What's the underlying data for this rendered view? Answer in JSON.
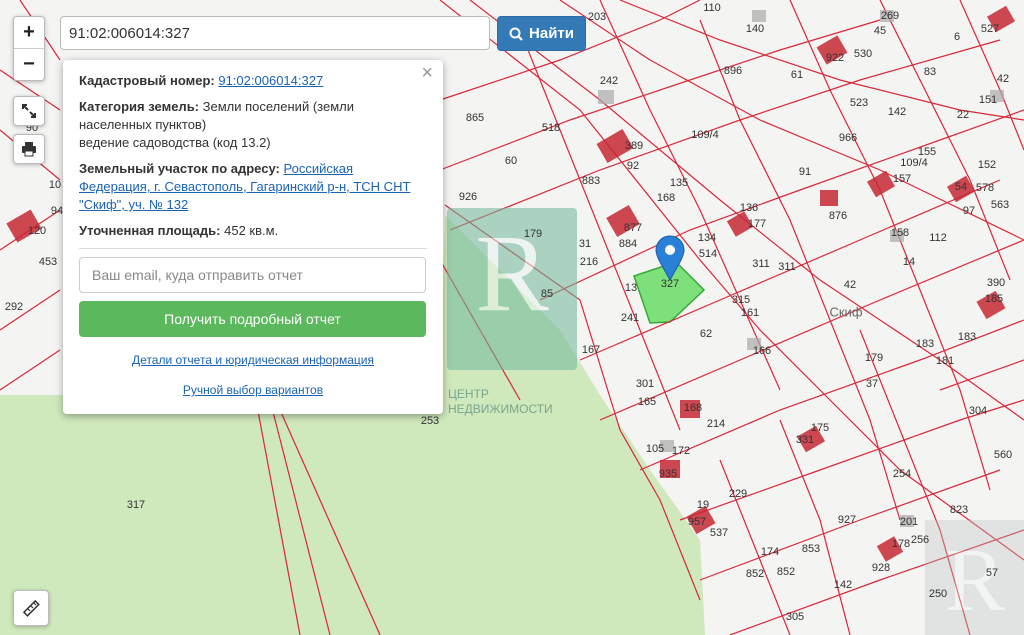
{
  "search": {
    "value": "91:02:006014:327",
    "button_label": "Найти"
  },
  "controls": {
    "zoom_in": "+",
    "zoom_out": "−"
  },
  "popup": {
    "cadastral_label": "Кадастровый номер:",
    "cadastral_value": "91:02:006014:327",
    "category_label": "Категория земель:",
    "category_value_1": "Земли поселений (земли",
    "category_value_2": "населенных пунктов)",
    "category_value_3": "ведение садоводства (код 13.2)",
    "address_label": "Земельный участок по адресу:",
    "address_link_1": "Российская",
    "address_link_2": "Федерация, г. Севастополь, Гагаринский р-н, ТСН СНТ",
    "address_link_3": "\"Скиф\", уч. № 132",
    "area_label": "Уточненная площадь:",
    "area_value": "452 кв.м.",
    "email_placeholder": "Ваш email, куда отправить отчет",
    "report_button": "Получить подробный отчет",
    "details_link": "Детали отчета и юридическая информация",
    "manual_link": "Ручной выбор вариантов"
  },
  "watermark": {
    "line1": "ЦЕНТР",
    "line2": "НЕДВИЖИМОСТИ"
  },
  "map_labels": [
    {
      "t": "203"
    },
    {
      "t": "110"
    },
    {
      "t": "140"
    },
    {
      "t": "269"
    },
    {
      "t": "45"
    },
    {
      "t": "6"
    },
    {
      "t": "527"
    },
    {
      "t": "242"
    },
    {
      "t": "896"
    },
    {
      "t": "61"
    },
    {
      "t": "922"
    },
    {
      "t": "530"
    },
    {
      "t": "83"
    },
    {
      "t": "42"
    },
    {
      "t": "151"
    },
    {
      "t": "865"
    },
    {
      "t": "518"
    },
    {
      "t": "109/4"
    },
    {
      "t": "523"
    },
    {
      "t": "142"
    },
    {
      "t": "22"
    },
    {
      "t": "389"
    },
    {
      "t": "92"
    },
    {
      "t": "966"
    },
    {
      "t": "155"
    },
    {
      "t": "60"
    },
    {
      "t": "91"
    },
    {
      "t": "109/4"
    },
    {
      "t": "157"
    },
    {
      "t": "152"
    },
    {
      "t": "883"
    },
    {
      "t": "135"
    },
    {
      "t": "168"
    },
    {
      "t": "54"
    },
    {
      "t": "578"
    },
    {
      "t": "563"
    },
    {
      "t": "97"
    },
    {
      "t": "926"
    },
    {
      "t": "877"
    },
    {
      "t": "884"
    },
    {
      "t": "136"
    },
    {
      "t": "177"
    },
    {
      "t": "876"
    },
    {
      "t": "158"
    },
    {
      "t": "112"
    },
    {
      "t": "179"
    },
    {
      "t": "31"
    },
    {
      "t": "134"
    },
    {
      "t": "514"
    },
    {
      "t": "311"
    },
    {
      "t": "311"
    },
    {
      "t": "14"
    },
    {
      "t": "216"
    },
    {
      "t": "85"
    },
    {
      "t": "13"
    },
    {
      "t": "327"
    },
    {
      "t": "315"
    },
    {
      "t": "161"
    },
    {
      "t": "42"
    },
    {
      "t": "390"
    },
    {
      "t": "185"
    },
    {
      "t": "241"
    },
    {
      "t": "62"
    },
    {
      "t": "Скиф"
    },
    {
      "t": "167"
    },
    {
      "t": "166"
    },
    {
      "t": "183"
    },
    {
      "t": "183"
    },
    {
      "t": "181"
    },
    {
      "t": "179"
    },
    {
      "t": "37"
    },
    {
      "t": "301"
    },
    {
      "t": "165"
    },
    {
      "t": "168"
    },
    {
      "t": "214"
    },
    {
      "t": "304"
    },
    {
      "t": "253"
    },
    {
      "t": "331"
    },
    {
      "t": "175"
    },
    {
      "t": "105"
    },
    {
      "t": "172"
    },
    {
      "t": "935"
    },
    {
      "t": "254"
    },
    {
      "t": "560"
    },
    {
      "t": "229"
    },
    {
      "t": "317"
    },
    {
      "t": "19"
    },
    {
      "t": "957"
    },
    {
      "t": "537"
    },
    {
      "t": "927"
    },
    {
      "t": "201"
    },
    {
      "t": "823"
    },
    {
      "t": "178"
    },
    {
      "t": "256"
    },
    {
      "t": "174"
    },
    {
      "t": "853"
    },
    {
      "t": "928"
    },
    {
      "t": "852"
    },
    {
      "t": "852"
    },
    {
      "t": "142"
    },
    {
      "t": "57"
    },
    {
      "t": "250"
    },
    {
      "t": "305"
    },
    {
      "t": "292"
    },
    {
      "t": "453"
    },
    {
      "t": "120"
    },
    {
      "t": "94"
    },
    {
      "t": "90"
    },
    {
      "t": "10"
    }
  ]
}
